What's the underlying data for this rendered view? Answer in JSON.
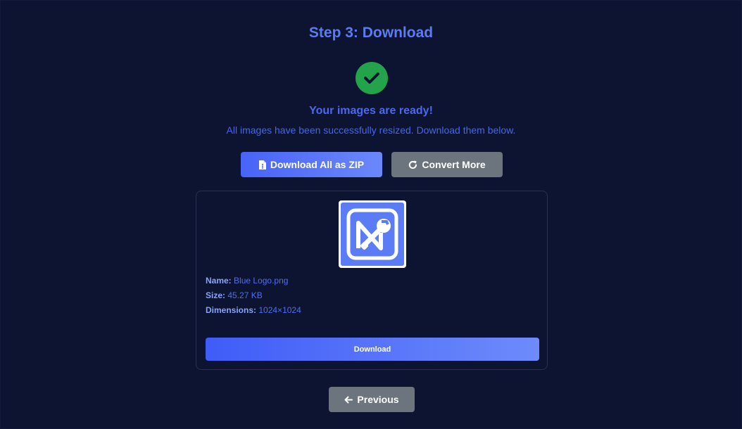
{
  "header": {
    "title": "Step 3: Download"
  },
  "status": {
    "icon": "check-icon",
    "heading": "Your images are ready!",
    "message": "All images have been successfully resized. Download them below."
  },
  "actions": {
    "download_zip_label": "Download All as ZIP",
    "download_zip_icon": "file-zip-icon",
    "convert_more_label": "Convert More",
    "convert_more_icon": "redo-icon"
  },
  "file": {
    "name_label": "Name:",
    "name": "Blue Logo.png",
    "size_label": "Size:",
    "size": "45.27 KB",
    "dimensions_label": "Dimensions:",
    "dimensions": "1024×1024",
    "download_label": "Download",
    "thumbnail_icon": "tools-logo-icon"
  },
  "navigation": {
    "previous_label": "Previous",
    "previous_icon": "arrow-left-icon"
  },
  "colors": {
    "background": "#0d1431",
    "accent": "#4f6ef7",
    "success": "#23a34a",
    "secondary": "#6c757d"
  }
}
